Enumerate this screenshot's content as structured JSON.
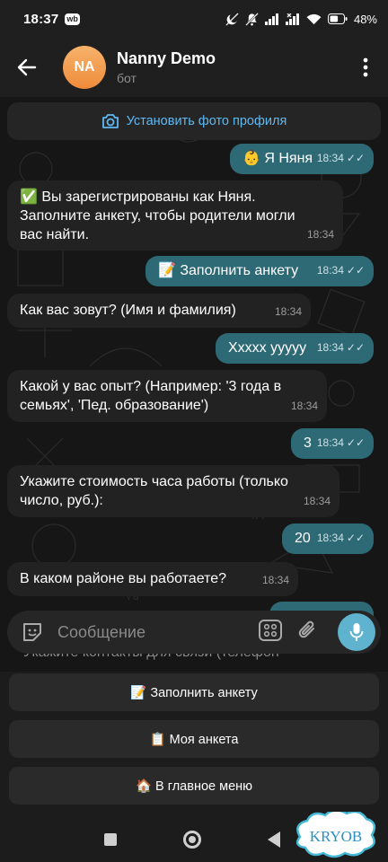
{
  "status_bar": {
    "time": "18:37",
    "app_badge": "wb",
    "battery": "48%"
  },
  "header": {
    "avatar_initials": "NA",
    "title": "Nanny Demo",
    "subtitle": "бот"
  },
  "chat": {
    "set_photo_label": "Установить фото профиля",
    "messages": [
      {
        "dir": "out",
        "text": "👶 Я Няня",
        "time": "18:34"
      },
      {
        "dir": "in",
        "text": "✅ Вы зарегистрированы как Няня. Заполните анкету, чтобы родители могли вас найти.",
        "time": "18:34"
      },
      {
        "dir": "out",
        "text": "📝 Заполнить анкету",
        "time": "18:34"
      },
      {
        "dir": "in",
        "text": "Как вас зовут? (Имя и фамилия)",
        "time": "18:34"
      },
      {
        "dir": "out",
        "text": "Xxxxx yyyyy",
        "time": "18:34"
      },
      {
        "dir": "in",
        "text": "Какой у вас опыт? (Например: '3 года в семьях', 'Пед. образование')",
        "time": "18:34"
      },
      {
        "dir": "out",
        "text": "3",
        "time": "18:34"
      },
      {
        "dir": "in",
        "text": "Укажите стоимость часа работы (только число, руб.):",
        "time": "18:34"
      },
      {
        "dir": "out",
        "text": "20",
        "time": "18:34"
      },
      {
        "dir": "in",
        "text": "В каком районе вы работаете?",
        "time": "18:34"
      }
    ],
    "peek_text": "Укажите контакты для связи (телефон"
  },
  "composer": {
    "placeholder": "Сообщение"
  },
  "keyboard": {
    "buttons": [
      {
        "label": "📝 Заполнить анкету"
      },
      {
        "label": "📋 Моя анкета"
      },
      {
        "label": "🏠 В главное меню"
      }
    ]
  },
  "watermark": {
    "text": "KRYOB"
  },
  "colors": {
    "incoming_bubble": "#222222",
    "outgoing_bubble": "#2e6a75",
    "accent": "#5fb9f2",
    "mic_button": "#5fb3cf"
  }
}
